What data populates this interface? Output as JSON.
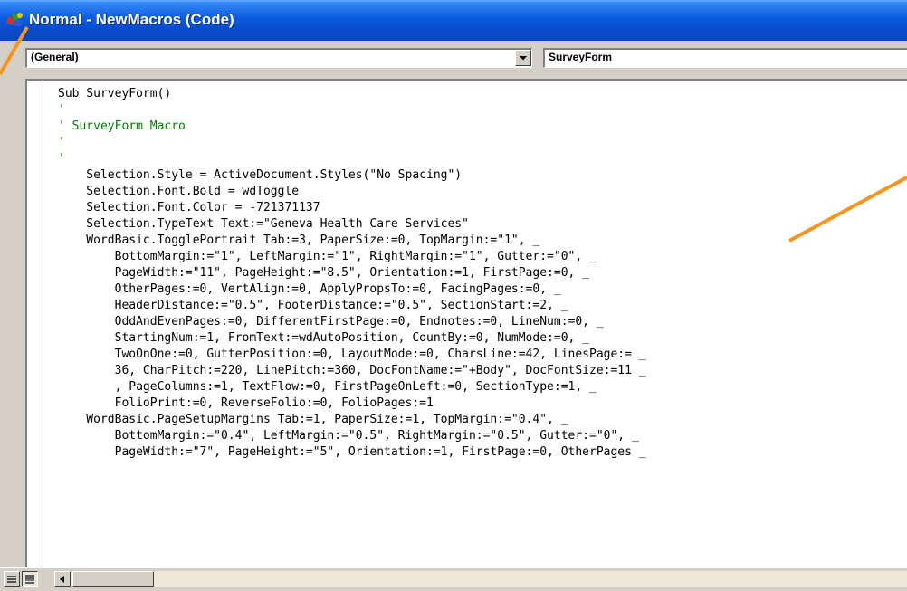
{
  "window": {
    "title": "Normal - NewMacros (Code)"
  },
  "combos": {
    "object": "(General)",
    "procedure": "SurveyForm"
  },
  "code_lines": [
    {
      "text": "Sub SurveyForm()",
      "style": "normal"
    },
    {
      "text": "'",
      "style": "comment"
    },
    {
      "text": "' SurveyForm Macro",
      "style": "comment"
    },
    {
      "text": "'",
      "style": "comment"
    },
    {
      "text": "'",
      "style": "comment"
    },
    {
      "text": "    Selection.Style = ActiveDocument.Styles(\"No Spacing\")",
      "style": "normal"
    },
    {
      "text": "    Selection.Font.Bold = wdToggle",
      "style": "normal"
    },
    {
      "text": "    Selection.Font.Color = -721371137",
      "style": "normal"
    },
    {
      "text": "    Selection.TypeText Text:=\"Geneva Health Care Services\"",
      "style": "normal"
    },
    {
      "text": "    WordBasic.TogglePortrait Tab:=3, PaperSize:=0, TopMargin:=\"1\", _",
      "style": "normal"
    },
    {
      "text": "        BottomMargin:=\"1\", LeftMargin:=\"1\", RightMargin:=\"1\", Gutter:=\"0\", _",
      "style": "normal"
    },
    {
      "text": "        PageWidth:=\"11\", PageHeight:=\"8.5\", Orientation:=1, FirstPage:=0, _",
      "style": "normal"
    },
    {
      "text": "        OtherPages:=0, VertAlign:=0, ApplyPropsTo:=0, FacingPages:=0, _",
      "style": "normal"
    },
    {
      "text": "        HeaderDistance:=\"0.5\", FooterDistance:=\"0.5\", SectionStart:=2, _",
      "style": "normal"
    },
    {
      "text": "        OddAndEvenPages:=0, DifferentFirstPage:=0, Endnotes:=0, LineNum:=0, _",
      "style": "normal"
    },
    {
      "text": "        StartingNum:=1, FromText:=wdAutoPosition, CountBy:=0, NumMode:=0, _",
      "style": "normal"
    },
    {
      "text": "        TwoOnOne:=0, GutterPosition:=0, LayoutMode:=0, CharsLine:=42, LinesPage:= _",
      "style": "normal"
    },
    {
      "text": "        36, CharPitch:=220, LinePitch:=360, DocFontName:=\"+Body\", DocFontSize:=11 _",
      "style": "normal"
    },
    {
      "text": "        , PageColumns:=1, TextFlow:=0, FirstPageOnLeft:=0, SectionType:=1, _",
      "style": "normal"
    },
    {
      "text": "        FolioPrint:=0, ReverseFolio:=0, FolioPages:=1",
      "style": "normal"
    },
    {
      "text": "    WordBasic.PageSetupMargins Tab:=1, PaperSize:=1, TopMargin:=\"0.4\", _",
      "style": "normal"
    },
    {
      "text": "        BottomMargin:=\"0.4\", LeftMargin:=\"0.5\", RightMargin:=\"0.5\", Gutter:=\"0\", _",
      "style": "normal"
    },
    {
      "text": "        PageWidth:=\"7\", PageHeight:=\"5\", Orientation:=1, FirstPage:=0, OtherPages _",
      "style": "normal"
    }
  ],
  "icons": {
    "title": "vba-module-icon",
    "dropdown": "chevron-down-icon",
    "procedure_view": "procedure-view-icon",
    "full_module_view": "full-module-view-icon",
    "scroll_left": "arrow-left-icon"
  },
  "colors": {
    "titlebar": "#0a4ccc",
    "comment": "#008000",
    "annotation_arrow": "#f7941d"
  }
}
